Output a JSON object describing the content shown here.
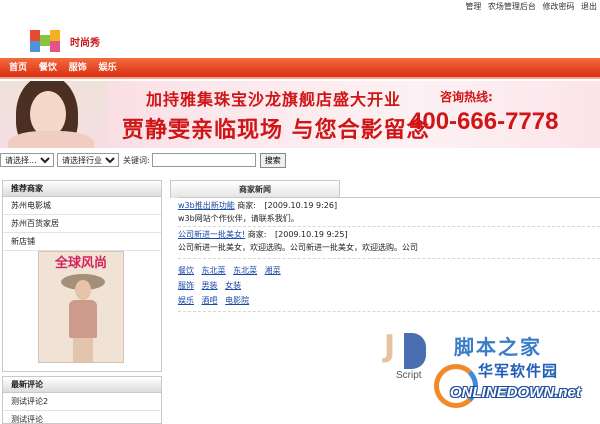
{
  "toplinks": [
    "管理",
    "农场管理后台",
    "修改密码",
    "退出"
  ],
  "logo": {
    "text": "时尚秀",
    "colors": [
      "#e84c2f",
      "#8ac43f",
      "#f3b01f",
      "#4e95d8",
      "#e3548a"
    ]
  },
  "nav": [
    "首页",
    "餐饮",
    "服饰",
    "娱乐"
  ],
  "banner": {
    "line1": "加持雅集珠宝沙龙旗舰店盛大开业",
    "line2": "贾静雯亲临现场 与您合影留念",
    "hotline_label": "咨询热线:",
    "phone": "400-666-7778"
  },
  "search": {
    "select1": "请选择...",
    "select2": "请选择行业",
    "keyword_label": "关键词:",
    "input_value": "",
    "button": "搜索"
  },
  "recommended": {
    "title": "推荐商家",
    "items": [
      "苏州电影城",
      "苏州百货家居",
      "新店铺"
    ]
  },
  "magazine_title": "全球风尚",
  "news": {
    "tab": "商家新闻",
    "items": [
      {
        "title": "w3b推出新功能",
        "author_label": "商家:",
        "author": "",
        "date": "[2009.10.19 9:26]",
        "snippet": "w3b网站个作伙伴，请联系我们。"
      },
      {
        "title": "公司新进一批美女!",
        "author_label": "商家:",
        "author": "",
        "date": "[2009.10.19 9:25]",
        "snippet": "公司新进一批美女，欢迎选购。公司新进一批美女，欢迎选购。公司"
      }
    ]
  },
  "categories": [
    [
      "餐饮",
      "东北菜",
      "东北菜",
      "湘菜"
    ],
    [
      "服饰",
      "男装",
      "女装"
    ],
    [
      "娱乐",
      "酒吧",
      "电影院"
    ]
  ],
  "latest_comments": {
    "title": "最新评论",
    "items": [
      "测试评论2",
      "测试评论"
    ]
  },
  "watermark_logo": {
    "brand": "脚本之家",
    "tag": "Script"
  },
  "watermark": {
    "cn": "华军软件园",
    "en": "ONLINEDOWN.net"
  }
}
